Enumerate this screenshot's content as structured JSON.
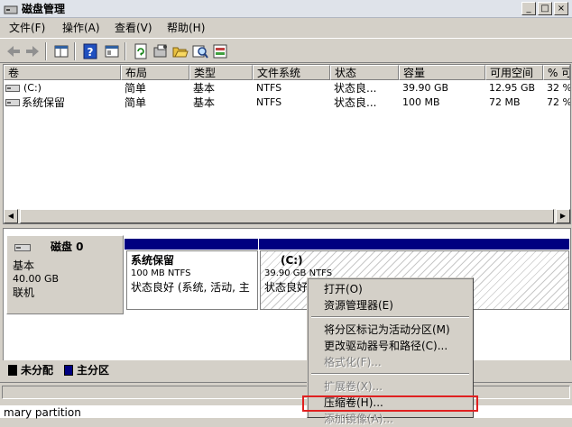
{
  "window": {
    "title": "磁盘管理",
    "minimize": "_",
    "maximize": "□",
    "close": "×"
  },
  "menu": [
    "文件(F)",
    "操作(A)",
    "查看(V)",
    "帮助(H)"
  ],
  "toolbar_icons": [
    "back-icon",
    "forward-icon",
    "properties-view-icon",
    "help-icon",
    "console-view-icon",
    "refresh-icon",
    "rescan-icon",
    "open-folder-icon",
    "search-icon",
    "export-icon"
  ],
  "volumes": {
    "headers": [
      "卷",
      "布局",
      "类型",
      "文件系统",
      "状态",
      "容量",
      "可用空间",
      "% 可"
    ],
    "rows": [
      [
        "(C:)",
        "简单",
        "基本",
        "NTFS",
        "状态良...",
        "39.90 GB",
        "12.95 GB",
        "32 %"
      ],
      [
        "系统保留",
        "简单",
        "基本",
        "NTFS",
        "状态良...",
        "100 MB",
        "72 MB",
        "72 %"
      ]
    ]
  },
  "disk": {
    "name": "磁盘 0",
    "type": "基本",
    "size": "40.00 GB",
    "status": "联机",
    "partitions": [
      {
        "name": "系统保留",
        "sub": "100 MB NTFS",
        "status": "状态良好 (系统, 活动, 主"
      },
      {
        "name": "(C:)",
        "sub": "39.90 GB NTFS",
        "status": "状态良好"
      }
    ]
  },
  "legend": [
    {
      "label": "未分配",
      "color": "#000000"
    },
    {
      "label": "主分区",
      "color": "#000080"
    }
  ],
  "context_menu": {
    "items": [
      {
        "label": "打开(O)",
        "enabled": true
      },
      {
        "label": "资源管理器(E)",
        "enabled": true
      },
      {
        "label": "将分区标记为活动分区(M)",
        "enabled": true
      },
      {
        "label": "更改驱动器号和路径(C)...",
        "enabled": true
      },
      {
        "label": "格式化(F)...",
        "enabled": false
      },
      {
        "label": "扩展卷(X)...",
        "enabled": false
      },
      {
        "label": "压缩卷(H)...",
        "enabled": true
      },
      {
        "label": "添加镜像(A)...",
        "enabled": false
      }
    ]
  },
  "bottom_text": "mary partition",
  "colors": {
    "partition_header": "#000080",
    "highlight": "#e02020"
  }
}
